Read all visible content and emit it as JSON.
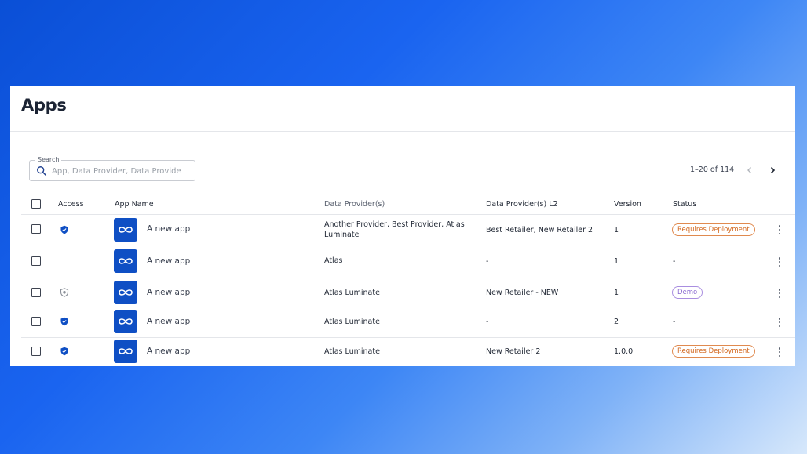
{
  "page": {
    "title": "Apps"
  },
  "search": {
    "legend": "Search",
    "placeholder": "App, Data Provider, Data Provide"
  },
  "pagination": {
    "range": "1–20 of 114"
  },
  "columns": {
    "access": "Access",
    "app_name": "App Name",
    "data_providers": "Data Provider(s)",
    "data_providers_l2": "Data Provider(s) L2",
    "version": "Version",
    "status": "Status"
  },
  "colors": {
    "brand": "#0f4fc4",
    "requires_deployment": "#d2661c",
    "demo": "#8a6ad0"
  },
  "rows": [
    {
      "access_icon": "shield-filled-icon",
      "app_name": "A new app",
      "data_providers": "Another Provider, Best Provider, Atlas Luminate",
      "data_providers_l2": "Best Retailer, New Retailer 2",
      "version": "1",
      "status": "Requires Deployment"
    },
    {
      "access_icon": "",
      "app_name": "A new app",
      "data_providers": "Atlas",
      "data_providers_l2": "-",
      "version": "1",
      "status": "-"
    },
    {
      "access_icon": "shield-outline-icon",
      "app_name": "A new app",
      "data_providers": "Atlas Luminate",
      "data_providers_l2": "New Retailer - NEW",
      "version": "1",
      "status": "Demo"
    },
    {
      "access_icon": "shield-filled-icon",
      "app_name": "A new app",
      "data_providers": "Atlas Luminate",
      "data_providers_l2": "-",
      "version": "2",
      "status": "-"
    },
    {
      "access_icon": "shield-filled-icon",
      "app_name": "A new app",
      "data_providers": "Atlas Luminate",
      "data_providers_l2": "New Retailer 2",
      "version": "1.0.0",
      "status": "Requires Deployment"
    }
  ]
}
